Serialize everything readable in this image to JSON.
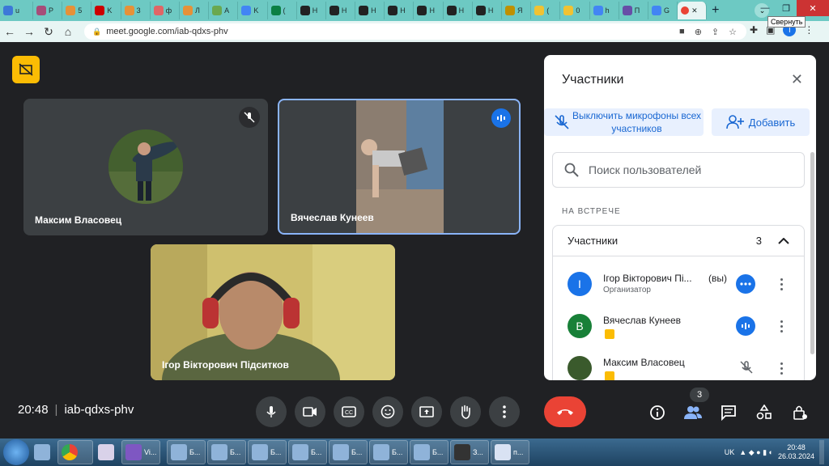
{
  "browser": {
    "tabs": [
      {
        "label": "u",
        "color": "#3c78d8"
      },
      {
        "label": "P",
        "color": "#a64d79"
      },
      {
        "label": "5",
        "color": "#e69138"
      },
      {
        "label": "K",
        "color": "#cc0000"
      },
      {
        "label": "3",
        "color": "#e69138"
      },
      {
        "label": "ф",
        "color": "#e06666"
      },
      {
        "label": "Л",
        "color": "#e69138"
      },
      {
        "label": "A",
        "color": "#6aa84f"
      },
      {
        "label": "K",
        "color": "#4285f4"
      },
      {
        "label": "(",
        "color": "#0b8043"
      },
      {
        "label": "Н",
        "color": "#222222"
      },
      {
        "label": "Н",
        "color": "#222222"
      },
      {
        "label": "Н",
        "color": "#222222"
      },
      {
        "label": "Н",
        "color": "#222222"
      },
      {
        "label": "Н",
        "color": "#222222"
      },
      {
        "label": "Н",
        "color": "#222222"
      },
      {
        "label": "Н",
        "color": "#222222"
      },
      {
        "label": "Я",
        "color": "#bf9000"
      },
      {
        "label": "(",
        "color": "#f1c232"
      },
      {
        "label": "0",
        "color": "#f1c232"
      },
      {
        "label": "h",
        "color": "#4285f4"
      },
      {
        "label": "П",
        "color": "#674ea7"
      },
      {
        "label": "G",
        "color": "#4285f4"
      }
    ],
    "active_tab_color": "#ea4335",
    "tooltip": "Свернуть",
    "url": "meet.google.com/iab-qdxs-phv",
    "profile_initial": "I"
  },
  "meet": {
    "tiles": [
      {
        "name": "Максим Власовец"
      },
      {
        "name": "Вячеслав Кунеев"
      },
      {
        "name": "Ігор Вікторович Підситков"
      }
    ],
    "time": "20:48",
    "meeting_code": "iab-qdxs-phv",
    "participants_count": "3"
  },
  "panel": {
    "title": "Участники",
    "mute_all_label": "Выключить микрофоны всех участников",
    "add_label": "Добавить",
    "search_placeholder": "Поиск пользователей",
    "section_label": "НА ВСТРЕЧЕ",
    "group_label": "Участники",
    "group_count": "3",
    "people": [
      {
        "initial": "I",
        "name": "Ігор Вікторович Пі...",
        "you": "(вы)",
        "role": "Организатор",
        "color": "#1a73e8"
      },
      {
        "initial": "В",
        "name": "Вячеслав Кунеев",
        "color": "#188038"
      },
      {
        "initial": "",
        "name": "Максим Власовец",
        "color": "#3a5a2c"
      }
    ]
  },
  "taskbar": {
    "items": [
      {
        "label": "Vi..."
      },
      {
        "label": "Б..."
      },
      {
        "label": "Б..."
      },
      {
        "label": "Б..."
      },
      {
        "label": "Б..."
      },
      {
        "label": "Б..."
      },
      {
        "label": "Б..."
      },
      {
        "label": "Б..."
      },
      {
        "label": "З..."
      },
      {
        "label": "п..."
      }
    ],
    "lang": "UK",
    "clock_time": "20:48",
    "clock_date": "26.03.2024"
  }
}
